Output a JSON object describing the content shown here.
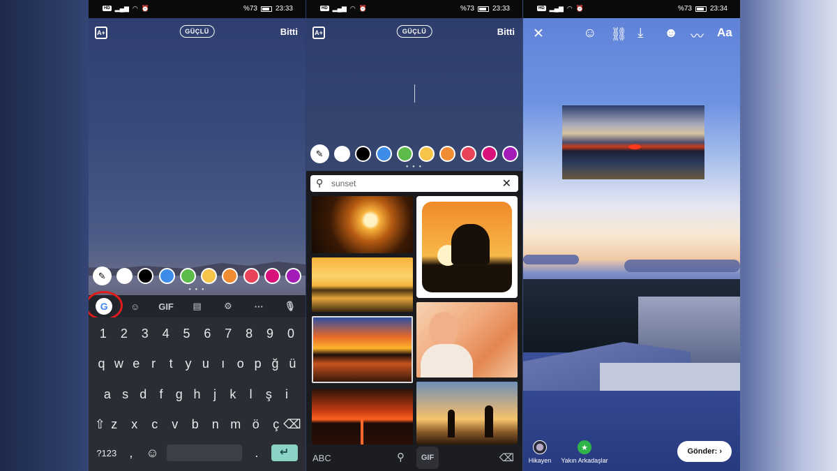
{
  "status_bar": [
    {
      "time": "23:33",
      "battery": "%73"
    },
    {
      "time": "23:33",
      "battery": "%73"
    },
    {
      "time": "23:34",
      "battery": "%73"
    }
  ],
  "text_editor": {
    "strength_label": "GÜÇLÜ",
    "done_label": "Bitti",
    "text_style_icon": "text-style-icon"
  },
  "palette_colors": [
    "#ffffff",
    "#000000",
    "#3d8ce8",
    "#5dbb4a",
    "#f7c44a",
    "#f28c32",
    "#e9435a",
    "#d8127a",
    "#a31cb8"
  ],
  "keyboard": {
    "toolbar": {
      "google_label": "G",
      "gif_label": "GIF",
      "more_label": "···"
    },
    "row_numbers": [
      "1",
      "2",
      "3",
      "4",
      "5",
      "6",
      "7",
      "8",
      "9",
      "0"
    ],
    "row_1": [
      "q",
      "w",
      "e",
      "r",
      "t",
      "y",
      "u",
      "ı",
      "o",
      "p",
      "ğ",
      "ü"
    ],
    "row_2": [
      "a",
      "s",
      "d",
      "f",
      "g",
      "h",
      "j",
      "k",
      "l",
      "ş",
      "i"
    ],
    "row_3": [
      "z",
      "x",
      "c",
      "v",
      "b",
      "n",
      "m",
      "ö",
      "ç"
    ],
    "symbols_label": "?123",
    "comma_label": ",",
    "period_label": "."
  },
  "gif_search": {
    "query": "sunset",
    "abc_label": "ABC",
    "gif_tab_label": "GIF"
  },
  "story": {
    "send_label": "Gönder:",
    "targets": [
      {
        "label": "Hikayen"
      },
      {
        "label": "Yakın Arkadaşlar"
      }
    ],
    "text_tool_label": "Aa"
  }
}
